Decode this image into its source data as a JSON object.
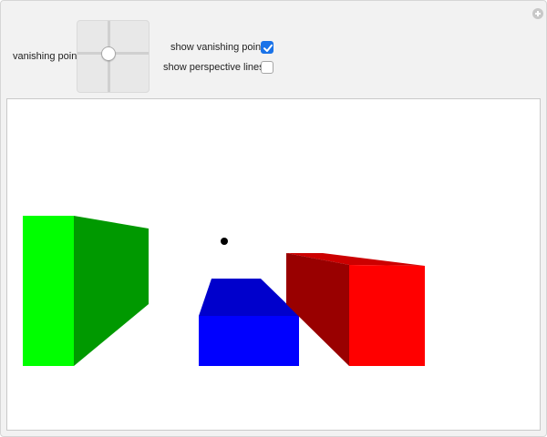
{
  "controls": {
    "vanishing_point_label": "vanishing point",
    "show_vanishing_point_label": "show vanishing point",
    "show_vanishing_point_checked": true,
    "show_perspective_lines_label": "show perspective lines",
    "show_perspective_lines_checked": false
  },
  "scene": {
    "colors": {
      "green_front": "#00ff00",
      "green_side": "#009900",
      "blue_front": "#0000ff",
      "blue_top": "#0000cc",
      "red_front": "#ff0000",
      "red_side": "#990000",
      "red_top": "#cc0000",
      "vanishing_point": "#000000"
    }
  }
}
